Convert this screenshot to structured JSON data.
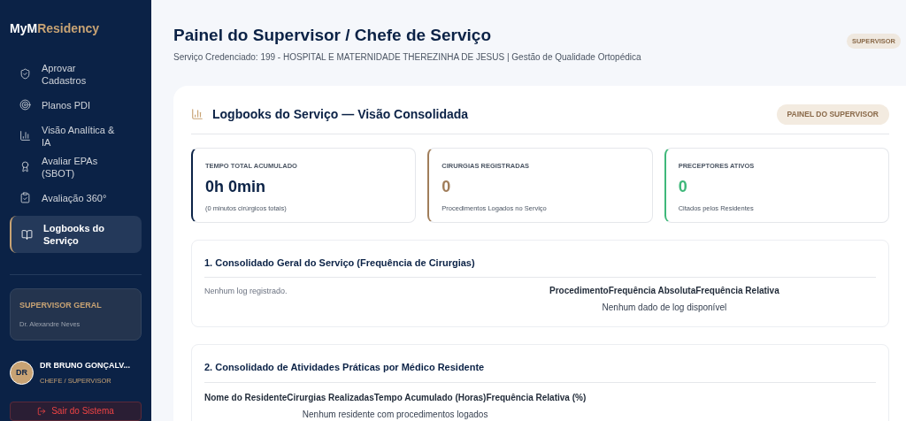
{
  "sidebar": {
    "logo": {
      "part_1": "MyM",
      "part_2": "Residency"
    },
    "items": [
      {
        "label": "Aprovar Cadastros",
        "kind": "shield",
        "selected": false
      },
      {
        "label": "Planos PDI",
        "kind": "target",
        "selected": false
      },
      {
        "label": "Visão Analítica & IA",
        "kind": "chart",
        "selected": false
      },
      {
        "label": "Avaliar EPAs (SBOT)",
        "kind": "award",
        "selected": false
      },
      {
        "label": "Avaliação 360°",
        "kind": "clipboard",
        "selected": false
      },
      {
        "label": "Logbooks do Serviço",
        "kind": "book",
        "selected": true
      }
    ],
    "role_card": {
      "title": "SUPERVISOR GERAL",
      "name": "Dr. Alexandre Neves"
    },
    "user": {
      "initials": "DR",
      "name": "DR BRUNO GONÇALV...",
      "role": "CHEFE / SUPERVISOR"
    },
    "logout": "Sair do Sistema"
  },
  "header": {
    "title": "Painel do Supervisor / Chefe de Serviço",
    "subtitle": "Serviço Credenciado: 199 - HOSPITAL E MATERNIDADE THEREZINHA DE JESUS | Gestão de Qualidade Ortopédica",
    "badge": "SUPERVISOR"
  },
  "panel": {
    "title": "Logbooks do Serviço — Visão Consolidada",
    "badge": "PAINEL DO SUPERVISOR",
    "stats": [
      {
        "label": "TEMPO TOTAL ACUMULADO",
        "value": "0h 0min",
        "note": "(0 minutos cirúrgicos totais)",
        "color": "#0b2246"
      },
      {
        "label": "CIRURGIAS REGISTRADAS",
        "value": "0",
        "note": "Procedimentos Logados no Serviço",
        "color": "#a07d5a"
      },
      {
        "label": "PRECEPTORES ATIVOS",
        "value": "0",
        "note": "Citados pelos Residentes",
        "color": "#3fb87a"
      }
    ],
    "section_1": {
      "title": "1. Consolidado Geral do Serviço (Frequência de Cirurgias)",
      "empty_note": "Nenhum log registrado.",
      "table": {
        "columns": [
          "Procedimento",
          "Frequência Absoluta",
          "Frequência Relativa"
        ],
        "empty": "Nenhum dado de log disponível"
      }
    },
    "section_2": {
      "title": "2. Consolidado de Atividades Práticas por Médico Residente",
      "table": {
        "columns": [
          "Nome do Residente",
          "Cirurgias Realizadas",
          "Tempo Acumulado (Horas)",
          "Frequência Relativa (%)"
        ],
        "empty": "Nenhum residente com procedimentos logados"
      }
    }
  }
}
